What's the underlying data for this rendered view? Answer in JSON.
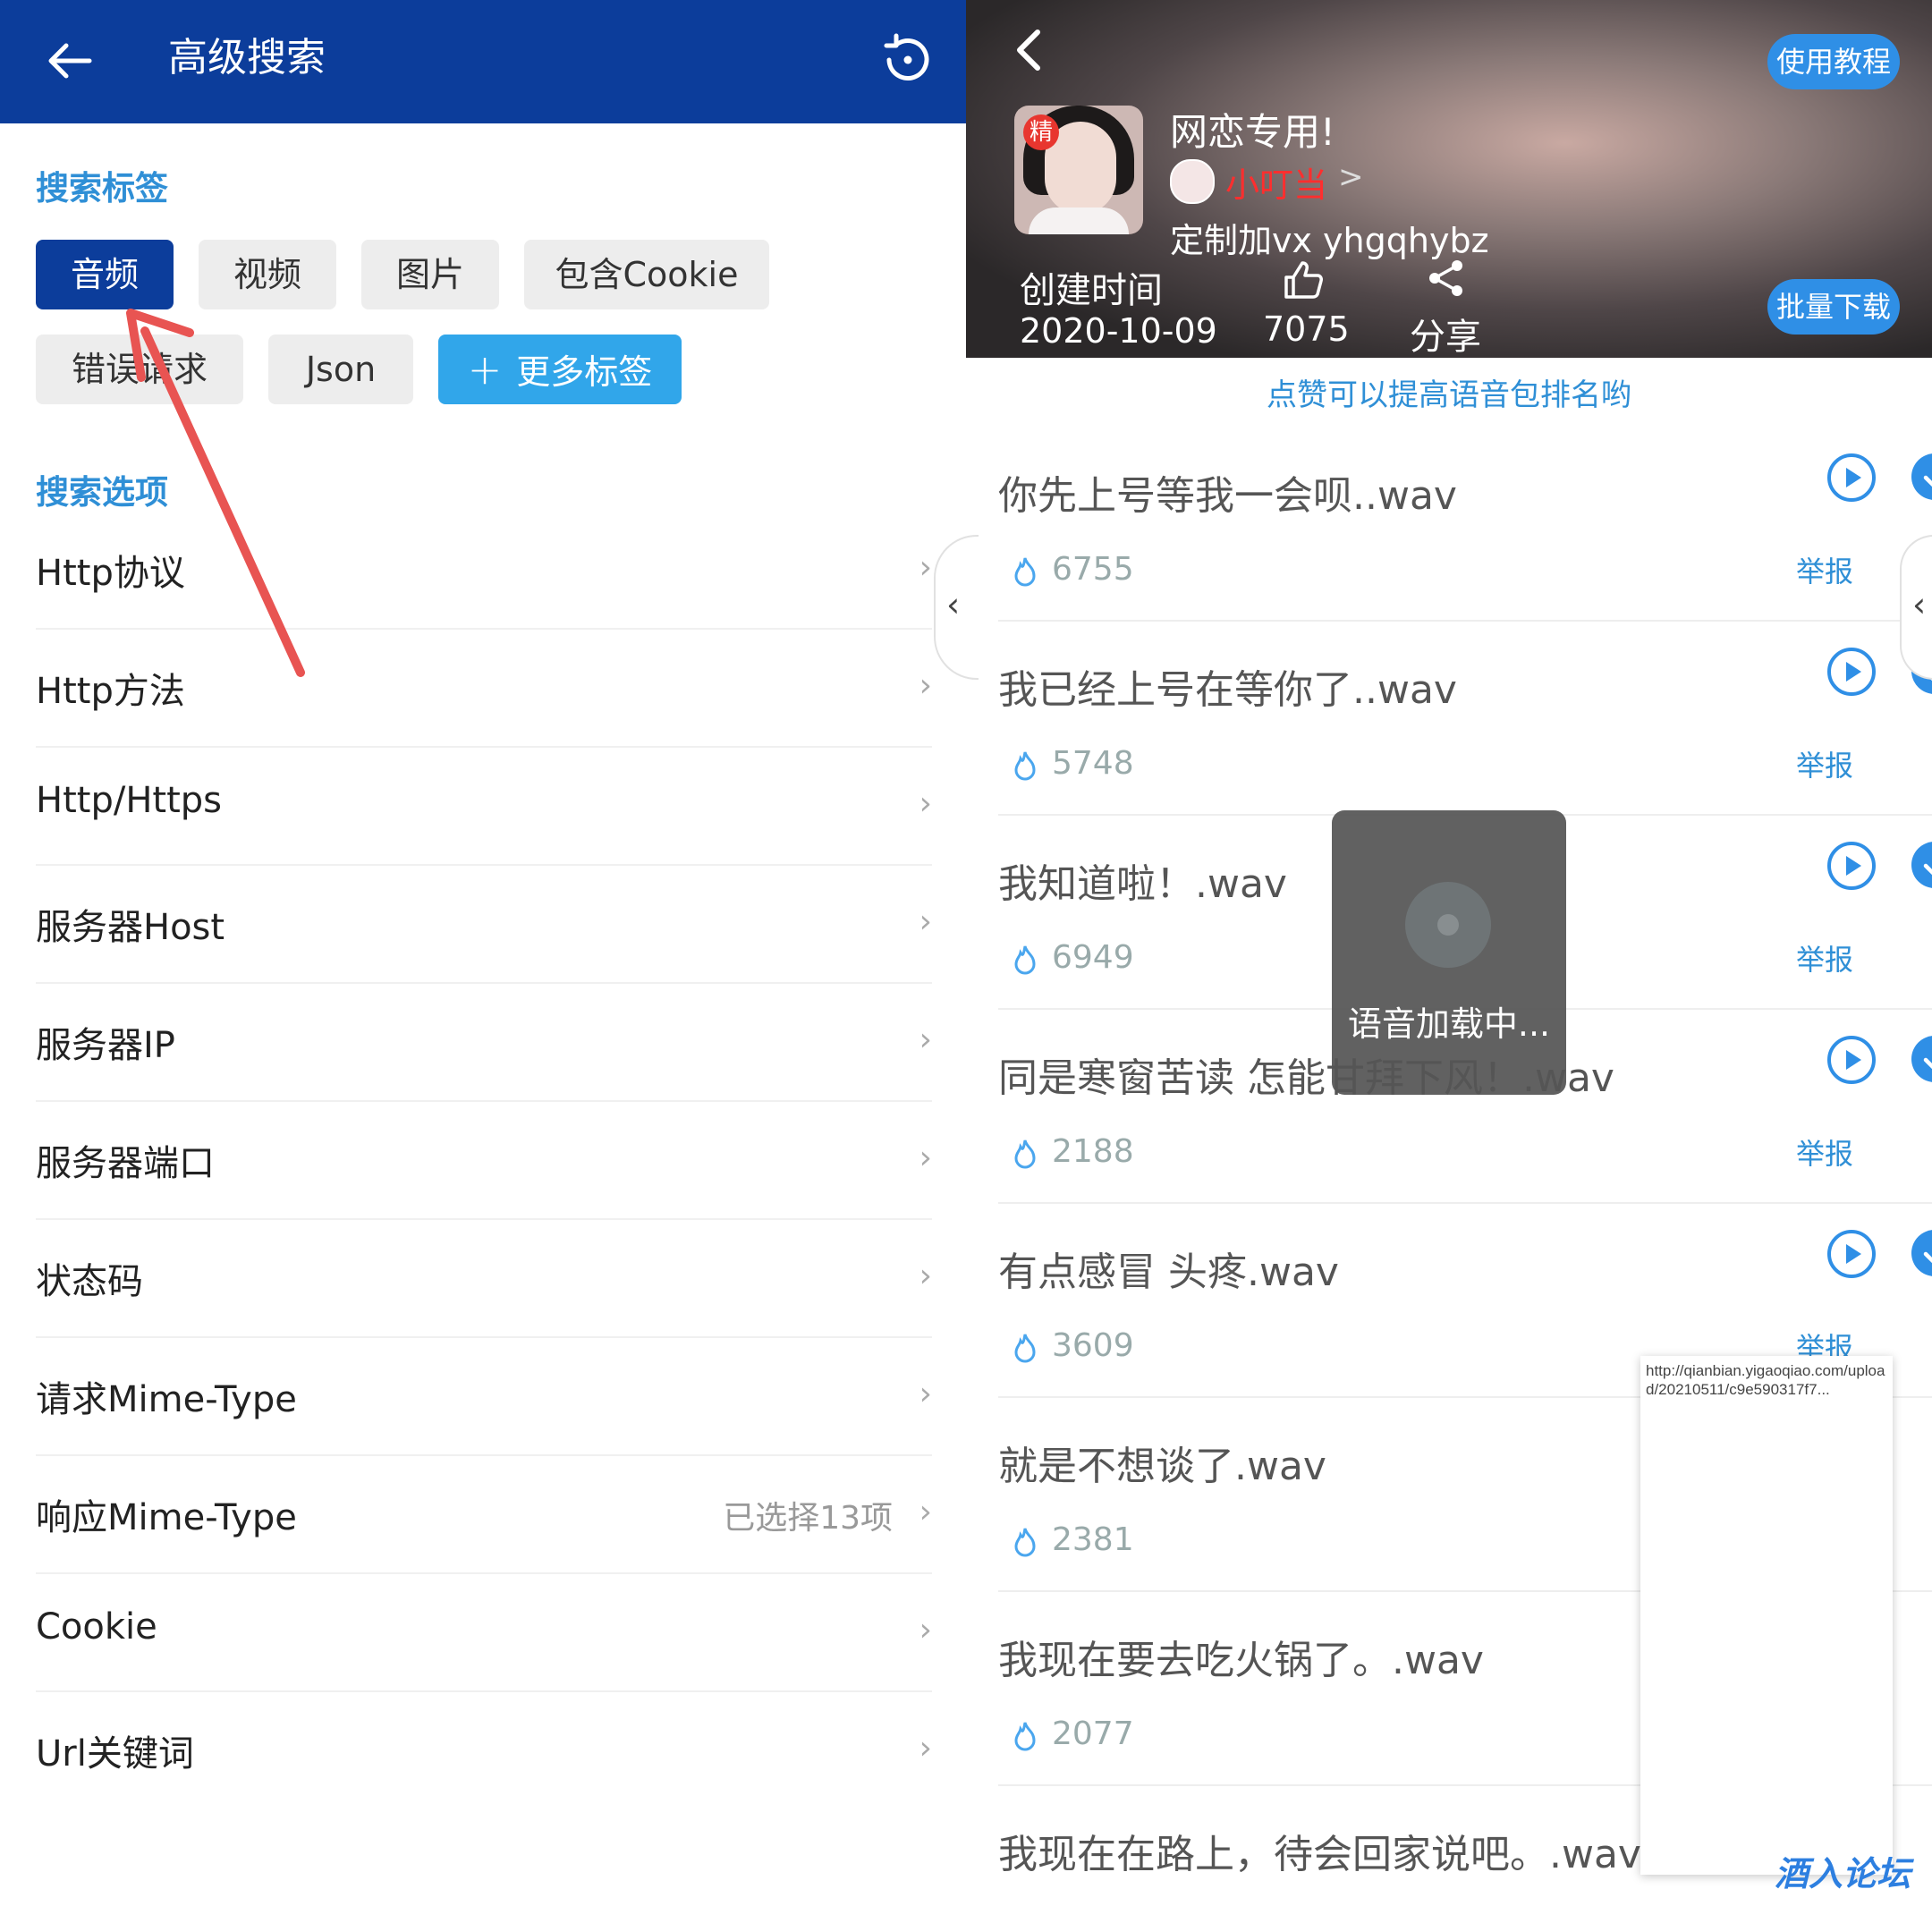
{
  "left": {
    "header": {
      "title": "高级搜索"
    },
    "tags_section": {
      "title": "搜索标签",
      "chips": [
        {
          "label": "音频",
          "active": true
        },
        {
          "label": "视频",
          "active": false
        },
        {
          "label": "图片",
          "active": false
        },
        {
          "label": "包含Cookie",
          "active": false
        },
        {
          "label": "错误请求",
          "active": false
        },
        {
          "label": "Json",
          "active": false
        }
      ],
      "more_label": "更多标签"
    },
    "options_section": {
      "title": "搜索选项",
      "rows": [
        {
          "label": "Http协议",
          "value": ""
        },
        {
          "label": "Http方法",
          "value": ""
        },
        {
          "label": "Http/Https",
          "value": ""
        },
        {
          "label": "服务器Host",
          "value": ""
        },
        {
          "label": "服务器IP",
          "value": ""
        },
        {
          "label": "服务器端口",
          "value": ""
        },
        {
          "label": "状态码",
          "value": ""
        },
        {
          "label": "请求Mime-Type",
          "value": ""
        },
        {
          "label": "响应Mime-Type",
          "value": "已选择13项"
        },
        {
          "label": "Cookie",
          "value": ""
        },
        {
          "label": "Url关键词",
          "value": ""
        }
      ],
      "chevron": "›"
    },
    "annotation_arrow_color": "#e85452"
  },
  "right": {
    "header": {
      "tutorial_label": "使用教程",
      "batch_label": "批量下载",
      "cover_badge": "精",
      "pack_title": "网恋专用!",
      "author": "小叮当",
      "author_chevron": ">",
      "description": "定制加vx yhgqhybz",
      "created_label": "创建时间",
      "created_date": "2020-10-09",
      "likes": "7075",
      "share_label": "分享"
    },
    "hint": "点赞可以提高语音包排名哟",
    "tracks": [
      {
        "name": "你先上号等我一会呗..wav",
        "count": "6755",
        "report": "举报"
      },
      {
        "name": "我已经上号在等你了..wav",
        "count": "5748",
        "report": "举报"
      },
      {
        "name": "我知道啦！.wav",
        "count": "6949",
        "report": "举报"
      },
      {
        "name": "同是寒窗苦读 怎能甘拜下风！.wav",
        "count": "2188",
        "report": "举报"
      },
      {
        "name": "有点感冒 头疼.wav",
        "count": "3609",
        "report": "举报"
      },
      {
        "name": "就是不想谈了.wav",
        "count": "2381",
        "report": ""
      },
      {
        "name": "我现在要去吃火锅了。.wav",
        "count": "2077",
        "report": ""
      },
      {
        "name": "我现在在路上，待会回家说吧。.wav",
        "count": "",
        "report": ""
      }
    ],
    "loading_text": "语音加载中...",
    "popup_url": "http://qianbian.yigaoqiao.com/upload/20210511/c9e590317f7...",
    "watermark": "酒入论坛",
    "accent_color": "#2f8fe6",
    "author_color": "#ff2e2e"
  },
  "side_tab_glyph": "‹"
}
